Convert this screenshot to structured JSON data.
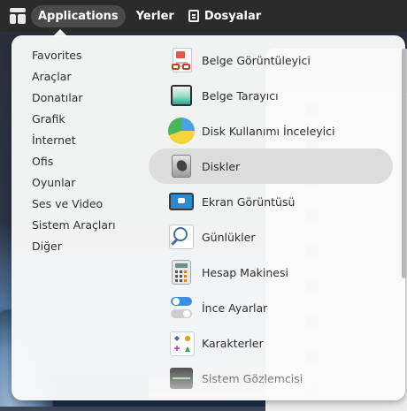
{
  "topbar": {
    "applications": "Applications",
    "places": "Yerler",
    "files": "Dosyalar"
  },
  "menu": {
    "categories": [
      "Favorites",
      "Araçlar",
      "Donatılar",
      "Grafik",
      "İnternet",
      "Ofis",
      "Oyunlar",
      "Ses ve Video",
      "Sistem Araçları",
      "Diğer"
    ],
    "apps": [
      {
        "label": "Belge Görüntüleyici",
        "icon": "document-viewer-icon"
      },
      {
        "label": "Belge Tarayıcı",
        "icon": "document-scanner-icon"
      },
      {
        "label": "Disk Kullanımı İnceleyici",
        "icon": "disk-usage-icon"
      },
      {
        "label": "Diskler",
        "icon": "disks-icon"
      },
      {
        "label": "Ekran Görüntüsü",
        "icon": "screenshot-icon"
      },
      {
        "label": "Günlükler",
        "icon": "logs-icon"
      },
      {
        "label": "Hesap Makinesi",
        "icon": "calculator-icon"
      },
      {
        "label": "İnce Ayarlar",
        "icon": "tweaks-icon"
      },
      {
        "label": "Karakterler",
        "icon": "characters-icon"
      },
      {
        "label": "Sistem Gözlemcisi",
        "icon": "system-monitor-icon"
      }
    ],
    "hovered_app": "Diskler"
  },
  "colors": {
    "topbar": "#2b2b2b",
    "menu_bg": "#fafafa",
    "hover": "#dcdcdc"
  }
}
